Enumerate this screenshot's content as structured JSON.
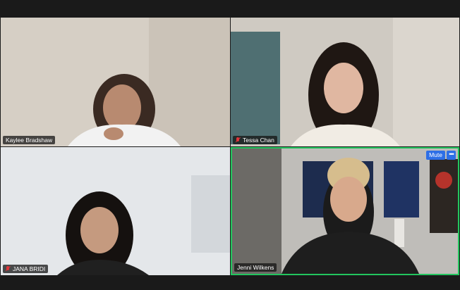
{
  "participants": [
    {
      "name": "Kaylee Bradshaw",
      "muted": false,
      "active": false
    },
    {
      "name": "Tessa Chan",
      "muted": true,
      "active": false
    },
    {
      "name": "JANA BRIDI",
      "muted": true,
      "active": false
    },
    {
      "name": "Jenni Wilkens",
      "muted": false,
      "active": true
    }
  ],
  "controls": {
    "mute_label": "Mute",
    "more_label": "•••"
  },
  "colors": {
    "active_speaker_border": "#23c55e",
    "button_blue": "#2e6fe6",
    "muted_red": "#e0353a"
  }
}
